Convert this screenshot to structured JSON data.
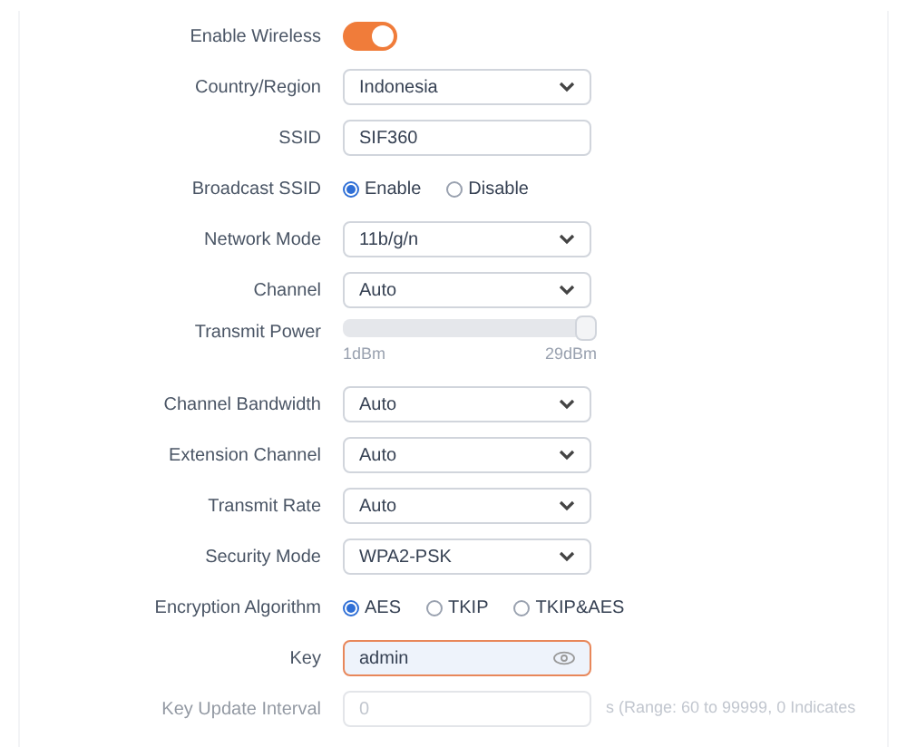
{
  "rows": [
    {
      "kind": "toggle",
      "label": "Enable Wireless",
      "on": true
    },
    {
      "kind": "select",
      "label": "Country/Region",
      "value": "Indonesia"
    },
    {
      "kind": "text",
      "label": "SSID",
      "value": "SIF360"
    },
    {
      "kind": "radio",
      "label": "Broadcast SSID",
      "options": [
        {
          "label": "Enable",
          "selected": true
        },
        {
          "label": "Disable",
          "selected": false
        }
      ]
    },
    {
      "kind": "select",
      "label": "Network Mode",
      "value": "11b/g/n"
    },
    {
      "kind": "select",
      "label": "Channel",
      "value": "Auto"
    },
    {
      "kind": "slider",
      "label": "Transmit Power",
      "level": 1.0,
      "min_label": "1dBm",
      "max_label": "29dBm",
      "disabled": true
    },
    {
      "kind": "select",
      "label": "Channel Bandwidth",
      "value": "Auto"
    },
    {
      "kind": "select",
      "label": "Extension Channel",
      "value": "Auto"
    },
    {
      "kind": "select",
      "label": "Transmit Rate",
      "value": "Auto"
    },
    {
      "kind": "select",
      "label": "Security Mode",
      "value": "WPA2-PSK"
    },
    {
      "kind": "radio",
      "label": "Encryption Algorithm",
      "options": [
        {
          "label": "AES",
          "selected": true
        },
        {
          "label": "TKIP",
          "selected": false
        },
        {
          "label": "TKIP&AES",
          "selected": false
        }
      ]
    },
    {
      "kind": "password",
      "label": "Key",
      "value": "admin",
      "focused": true
    },
    {
      "kind": "text",
      "label": "Key Update Interval",
      "value": "0",
      "note": "s (Range: 60 to 99999, 0 Indicates",
      "disabled": true
    }
  ]
}
